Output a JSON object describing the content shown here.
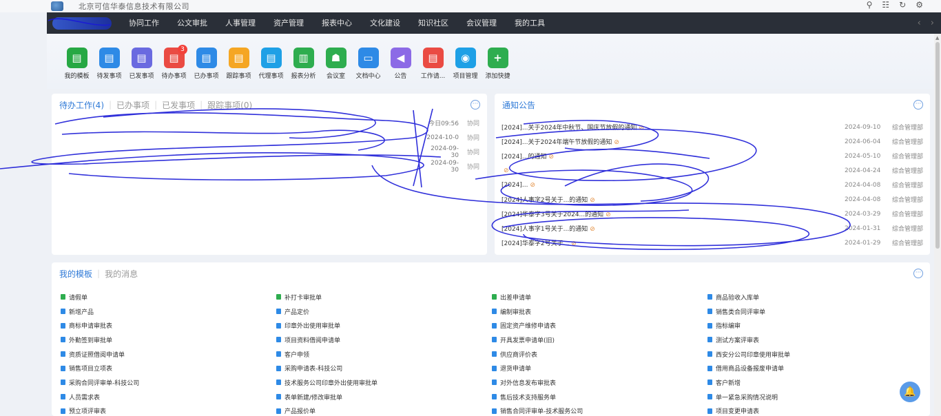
{
  "header": {
    "company": "北京可信华泰信息技术有限公司",
    "tools": [
      "⚲",
      "☷",
      "↻",
      "⚙"
    ]
  },
  "nav": {
    "items": [
      "协同工作",
      "公文审批",
      "人事管理",
      "资产管理",
      "报表中心",
      "文化建设",
      "知识社区",
      "会议管理",
      "我的工具"
    ],
    "arrows": [
      "‹",
      "›"
    ]
  },
  "shortcuts": [
    {
      "label": "我的模板",
      "color": "#27a844",
      "glyph": "▤"
    },
    {
      "label": "待发事项",
      "color": "#2e8ae6",
      "glyph": "▤"
    },
    {
      "label": "已发事项",
      "color": "#6a6ae0",
      "glyph": "▤"
    },
    {
      "label": "待办事项",
      "color": "#ea4b43",
      "glyph": "▤",
      "badge": "3"
    },
    {
      "label": "已办事项",
      "color": "#2e8ae6",
      "glyph": "▤"
    },
    {
      "label": "跟踪事项",
      "color": "#f5a623",
      "glyph": "▤"
    },
    {
      "label": "代理事项",
      "color": "#1ea0e6",
      "glyph": "▤"
    },
    {
      "label": "报表分析",
      "color": "#2ead4f",
      "glyph": "▥"
    },
    {
      "label": "会议室",
      "color": "#2ead4f",
      "glyph": "☗"
    },
    {
      "label": "文档中心",
      "color": "#2e8ae6",
      "glyph": "▭"
    },
    {
      "label": "公告",
      "color": "#8c6ae6",
      "glyph": "◀"
    },
    {
      "label": "工作请...",
      "color": "#ea4b43",
      "glyph": "▤"
    },
    {
      "label": "项目管理",
      "color": "#1ea0e6",
      "glyph": "◉"
    },
    {
      "label": "添加快捷",
      "color": "#2ead4f",
      "glyph": "+"
    }
  ],
  "todo": {
    "tabs": [
      "待办工作(4)",
      "已办事项",
      "已发事项",
      "跟踪事项(0)"
    ],
    "more": "···",
    "rows": [
      {
        "title": "",
        "date": "今日09:56",
        "category": "协同"
      },
      {
        "title": "",
        "date": "2024-10-0",
        "category": "协同"
      },
      {
        "title": "",
        "date": "2024-09-30",
        "category": "协同"
      },
      {
        "title": "",
        "date": "2024-09-30",
        "category": "协同"
      }
    ]
  },
  "notice": {
    "tab": "通知公告",
    "more": "···",
    "rows": [
      {
        "title": "[2024]...关于2024年中秋节、国庆节放假的通知",
        "date": "2024-09-10",
        "source": "综合管理部"
      },
      {
        "title": "[2024]...关于2024年端午节放假的通知",
        "date": "2024-06-04",
        "source": "综合管理部"
      },
      {
        "title": "[2024]...的通知",
        "date": "2024-05-10",
        "source": "综合管理部"
      },
      {
        "title": "",
        "date": "2024-04-24",
        "source": "综合管理部"
      },
      {
        "title": "[2024]...",
        "date": "2024-04-08",
        "source": "综合管理部"
      },
      {
        "title": "[2024]人事字2号关于...的通知",
        "date": "2024-04-08",
        "source": "综合管理部"
      },
      {
        "title": "[2024]华泰字3号关于2024...的通知",
        "date": "2024-03-29",
        "source": "综合管理部"
      },
      {
        "title": "[2024]人事字1号关于...的通知",
        "date": "2024-01-31",
        "source": "综合管理部"
      },
      {
        "title": "[2024]华泰字2号关于...",
        "date": "2024-01-29",
        "source": "综合管理部"
      }
    ]
  },
  "templates": {
    "tabs": [
      "我的模板",
      "我的消息"
    ],
    "more": "···",
    "items": [
      {
        "label": "请假单",
        "color": "#2ead4f"
      },
      {
        "label": "补打卡审批单",
        "color": "#2ead4f"
      },
      {
        "label": "出差申请单",
        "color": "#2ead4f"
      },
      {
        "label": "商品验收入库单",
        "color": "#2e8ae6"
      },
      {
        "label": "新增产品",
        "color": "#2e8ae6"
      },
      {
        "label": "产品定价",
        "color": "#2e8ae6"
      },
      {
        "label": "编制审批表",
        "color": "#2e8ae6"
      },
      {
        "label": "销售类合同评审单",
        "color": "#2e8ae6"
      },
      {
        "label": "商标申请审批表",
        "color": "#2e8ae6"
      },
      {
        "label": "印章外出使用审批单",
        "color": "#2e8ae6"
      },
      {
        "label": "固定资产维修申请表",
        "color": "#2e8ae6"
      },
      {
        "label": "指标编审",
        "color": "#2e8ae6"
      },
      {
        "label": "外勤签到审批单",
        "color": "#2e8ae6"
      },
      {
        "label": "项目资料借阅申请单",
        "color": "#2e8ae6"
      },
      {
        "label": "开具发票申请单(旧)",
        "color": "#2e8ae6"
      },
      {
        "label": "测试方案评审表",
        "color": "#2e8ae6"
      },
      {
        "label": "资质证照借阅申请单",
        "color": "#2e8ae6"
      },
      {
        "label": "客户申领",
        "color": "#2e8ae6"
      },
      {
        "label": "供应商评价表",
        "color": "#2e8ae6"
      },
      {
        "label": "西安分公司印章使用审批单",
        "color": "#2e8ae6"
      },
      {
        "label": "销售项目立项表",
        "color": "#2e8ae6"
      },
      {
        "label": "采购申请表-科技公司",
        "color": "#2e8ae6"
      },
      {
        "label": "退货申请单",
        "color": "#2e8ae6"
      },
      {
        "label": "借用商品设备报废申请单",
        "color": "#2e8ae6"
      },
      {
        "label": "采购合同评审单-科技公司",
        "color": "#2e8ae6"
      },
      {
        "label": "技术服务公司印章外出使用审批单",
        "color": "#2e8ae6"
      },
      {
        "label": "对外信息发布审批表",
        "color": "#2e8ae6"
      },
      {
        "label": "客户新增",
        "color": "#2e8ae6"
      },
      {
        "label": "人员需求表",
        "color": "#2e8ae6"
      },
      {
        "label": "表单新建/修改审批单",
        "color": "#2e8ae6"
      },
      {
        "label": "售后技术支持服务单",
        "color": "#2e8ae6"
      },
      {
        "label": "单一紧急采购情况说明",
        "color": "#2e8ae6"
      },
      {
        "label": "预立项评审表",
        "color": "#2e8ae6"
      },
      {
        "label": "产品报价单",
        "color": "#2e8ae6"
      },
      {
        "label": "销售合同评审单-技术服务公司",
        "color": "#2e8ae6"
      },
      {
        "label": "项目变更申请表",
        "color": "#2e8ae6"
      }
    ]
  },
  "float_button": {
    "icon": "bell-icon",
    "glyph": "🔔"
  }
}
